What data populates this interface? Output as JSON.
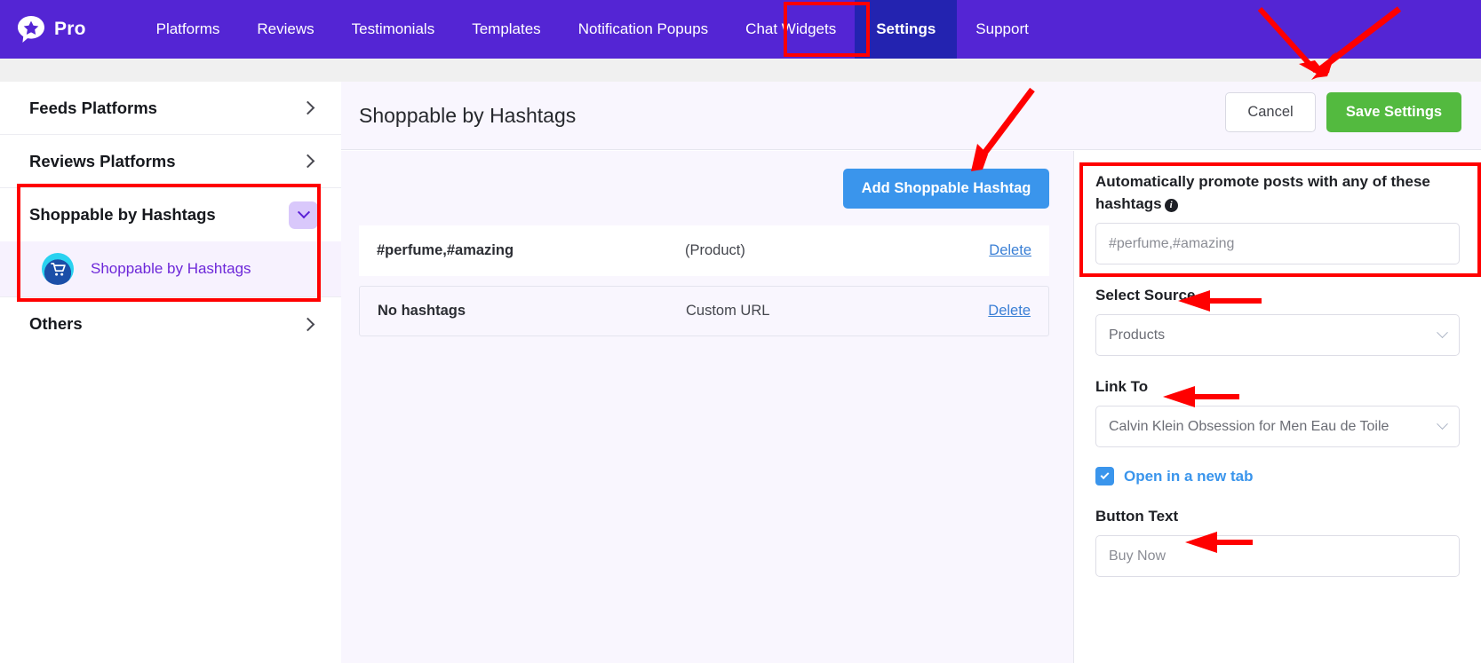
{
  "topnav": {
    "brand": "Pro",
    "items": [
      {
        "label": "Platforms",
        "active": false
      },
      {
        "label": "Reviews",
        "active": false
      },
      {
        "label": "Testimonials",
        "active": false
      },
      {
        "label": "Templates",
        "active": false
      },
      {
        "label": "Notification Popups",
        "active": false
      },
      {
        "label": "Chat Widgets",
        "active": false
      },
      {
        "label": "Settings",
        "active": true
      },
      {
        "label": "Support",
        "active": false
      }
    ],
    "bg_color": "#5425d4",
    "active_bg_color": "#2323b0"
  },
  "sidebar": {
    "items": [
      {
        "label": "Feeds Platforms",
        "expanded": false
      },
      {
        "label": "Reviews Platforms",
        "expanded": false
      },
      {
        "label": "Shoppable by Hashtags",
        "expanded": true
      },
      {
        "label": "Others",
        "expanded": false
      }
    ],
    "sub_item": {
      "label": "Shoppable by Hashtags",
      "icon": "shopping-cart-icon",
      "color": "#6d28d9"
    }
  },
  "main": {
    "page_title": "Shoppable by Hashtags",
    "cancel_label": "Cancel",
    "save_label": "Save Settings",
    "add_label": "Add Shoppable Hashtag",
    "accent_blue": "#3a95ec",
    "accent_green": "#53ba3f",
    "table": {
      "rows": [
        {
          "hashtags": "#perfume,#amazing",
          "type": "(Product)",
          "delete_label": "Delete"
        },
        {
          "hashtags": "No hashtags",
          "type": "Custom URL",
          "delete_label": "Delete"
        }
      ]
    }
  },
  "form": {
    "promote_label": "Automatically promote posts with any of these hashtags",
    "promote_value": "#perfume,#amazing",
    "promote_placeholder": "#perfume,#amazing",
    "select_source_label": "Select Source",
    "select_source_value": "Products",
    "link_to_label": "Link To",
    "link_to_value": "Calvin Klein Obsession for Men Eau de Toile",
    "open_new_tab_label": "Open in a new tab",
    "open_new_tab_checked": true,
    "button_text_label": "Button Text",
    "button_text_value": "Buy Now"
  },
  "annotations": {
    "highlight_color": "#ff0000"
  }
}
